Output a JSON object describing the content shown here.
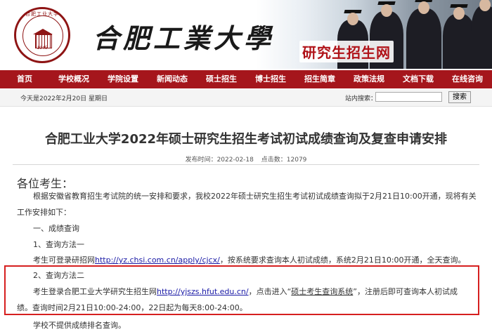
{
  "header": {
    "seal_text": "合肥工业大学",
    "seal_year": "1945",
    "university_name": "合肥工業大學",
    "site_title": "研究生招生网"
  },
  "nav": {
    "items": [
      "首页",
      "学校概况",
      "学院设置",
      "新闻动态",
      "硕士招生",
      "博士招生",
      "招生简章",
      "政策法规",
      "文档下载",
      "在线咨询"
    ]
  },
  "infobar": {
    "date": "今天是2022年2月20日 星期日",
    "search_label": "站内搜索：",
    "search_value": "",
    "search_button": "搜索"
  },
  "article": {
    "title": "合肥工业大学2022年硕士研究生招生考试初试成绩查询及复查申请安排",
    "published_label": "发布时间：2022-02-18",
    "clicks_label": "点击数：12079",
    "greeting": "各位考生：",
    "intro_line1": "根据安徽省教育招生考试院的统一安排和要求，我校2022年硕士研究生招生考试初试成绩查询拟于2月21日10:00开通，现将有关",
    "intro_line2": "工作安排如下：",
    "section1": "一、成绩查询",
    "method1_title": "1、查询方法一",
    "method1_prefix": "考生可登录研招网",
    "method1_link": "http://yz.chsi.com.cn/apply/cjcx/",
    "method1_suffix": "，按系统要求查询本人初试成绩，系统2月21日10:00开通，全天查询。",
    "method2_title": "2、查询方法二",
    "method2_prefix": "考生登录合肥工业大学研究生招生网",
    "method2_link": "http://yjszs.hfut.edu.cn/",
    "method2_mid": "，点击进入“",
    "method2_system": "硕士考生查询系统",
    "method2_suffix": "”，注册后即可查询本人初试成",
    "method2_line2": "绩。查询时间2月21日10:00-24:00，22日起为每天8:00-24:00。",
    "note": "学校不提供成绩排名查询。"
  },
  "colors": {
    "nav_bg": "#a5161c",
    "highlight_border": "#d61f1f",
    "link": "#1a1aa6"
  }
}
